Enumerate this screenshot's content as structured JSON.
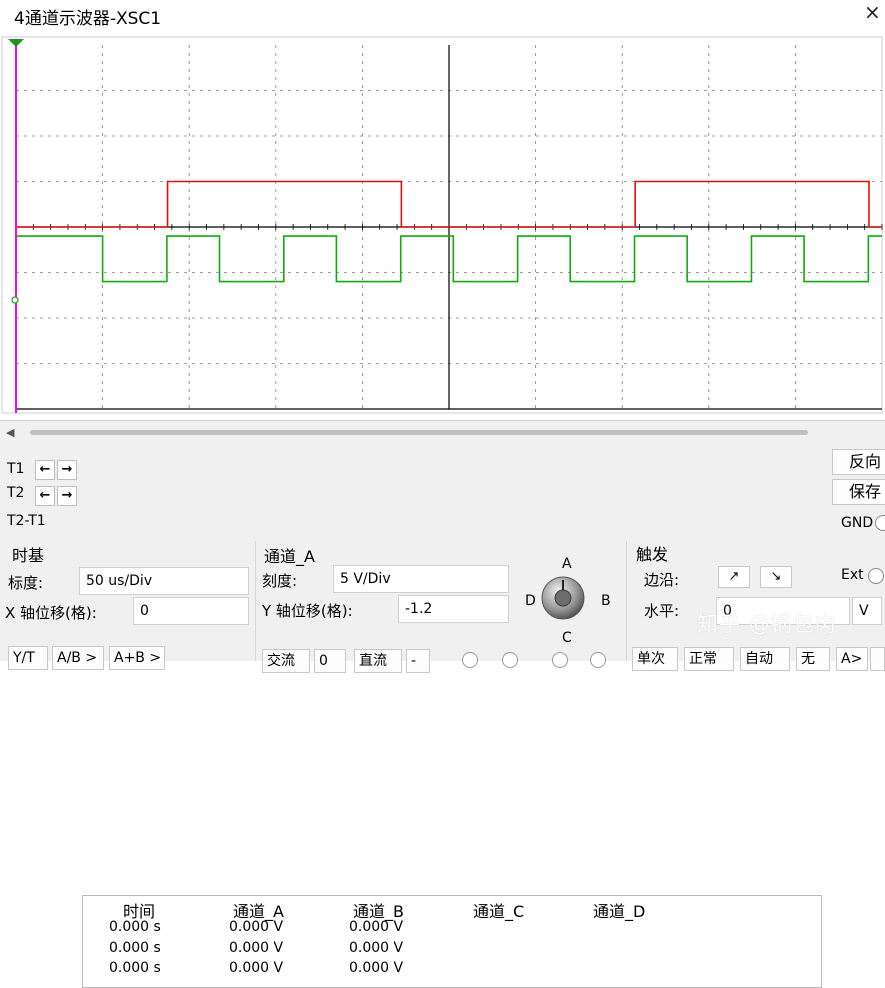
{
  "window": {
    "title": "4通道示波器-XSC1",
    "close_glyph": "×"
  },
  "readout": {
    "rows": [
      {
        "label": "T1",
        "time": "0.000 s",
        "a": "0.000 V",
        "b": "0.000 V"
      },
      {
        "label": "T2",
        "time": "0.000 s",
        "a": "0.000 V",
        "b": "0.000 V"
      },
      {
        "label": "T2-T1",
        "time": "0.000 s",
        "a": "0.000 V",
        "b": "0.000 V"
      }
    ],
    "headers": {
      "time": "时间",
      "a": "通道_A",
      "b": "通道_B",
      "c": "通道_C",
      "d": "通道_D"
    },
    "reverse_label": "反向",
    "save_label": "保存",
    "gnd_label": "GND"
  },
  "timebase": {
    "title": "时基",
    "scale_label": "标度:",
    "scale_value": "50 us/Div",
    "xpos_label": "X 轴位移(格):",
    "xpos_value": "0",
    "buttons": [
      "Y/T",
      "A/B >",
      "A+B >"
    ]
  },
  "channel": {
    "title": "通道_A",
    "scale_label": "刻度:",
    "scale_value": "5  V/Div",
    "ypos_label": "Y 轴位移(格):",
    "ypos_value": "-1.2",
    "knob_labels": {
      "top": "A",
      "left": "D",
      "right": "B",
      "bottom": "C"
    },
    "coupling_buttons": [
      "交流",
      "0",
      "直流",
      "-"
    ]
  },
  "trigger": {
    "title": "触发",
    "edge_label": "边沿:",
    "edge_rise": "↗",
    "edge_fall": "↘",
    "ext_label": "Ext",
    "level_label": "水平:",
    "level_value": "0",
    "level_unit": "V",
    "mode_buttons": [
      "单次",
      "正常",
      "自动",
      "无"
    ],
    "extra_button": "A>"
  },
  "watermark": "知乎 @锅包肉",
  "colors": {
    "channel_a": "#dd1111",
    "channel_b": "#11aa11",
    "cursor": "#ff00ff",
    "grid": "#808080"
  },
  "scope_state": {
    "x_range_div": [
      0,
      10
    ],
    "y_range_div": [
      -4,
      4
    ],
    "channel_a": {
      "high_div": 1,
      "low_div": 0,
      "period_div": 5.4,
      "duty": 0.5,
      "rise_at_div": 1.75
    },
    "channel_b": {
      "high_div": -0.2,
      "low_div": -1.2,
      "period_div": 1.35,
      "duty": 0.45,
      "fall_at_div": 1.0
    }
  }
}
